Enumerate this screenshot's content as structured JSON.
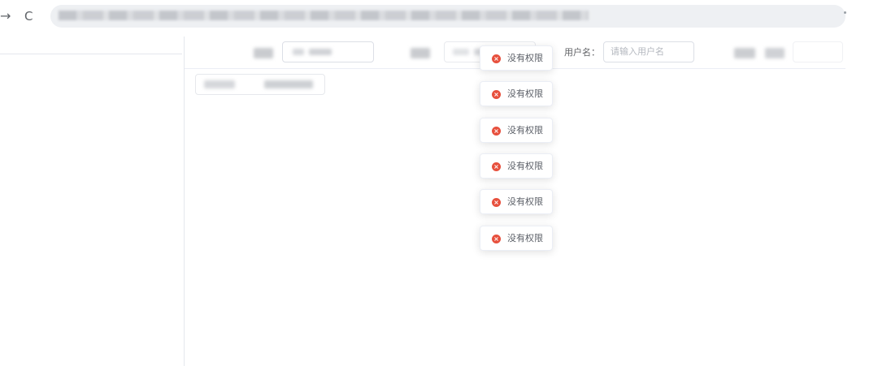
{
  "browser": {
    "forward_glyph": "→",
    "reload_glyph": "C"
  },
  "filters": {
    "username_label": "用户名：",
    "username_placeholder": "请输入用户名"
  },
  "toasts": [
    {
      "icon": "error-icon",
      "text": "没有权限"
    },
    {
      "icon": "error-icon",
      "text": "没有权限"
    },
    {
      "icon": "error-icon",
      "text": "没有权限"
    },
    {
      "icon": "error-icon",
      "text": "没有权限"
    },
    {
      "icon": "error-icon",
      "text": "没有权限"
    },
    {
      "icon": "error-icon",
      "text": "没有权限"
    }
  ],
  "colors": {
    "error": "#e7503d",
    "border": "#dcdfe6",
    "placeholder": "#b4b8bf"
  }
}
